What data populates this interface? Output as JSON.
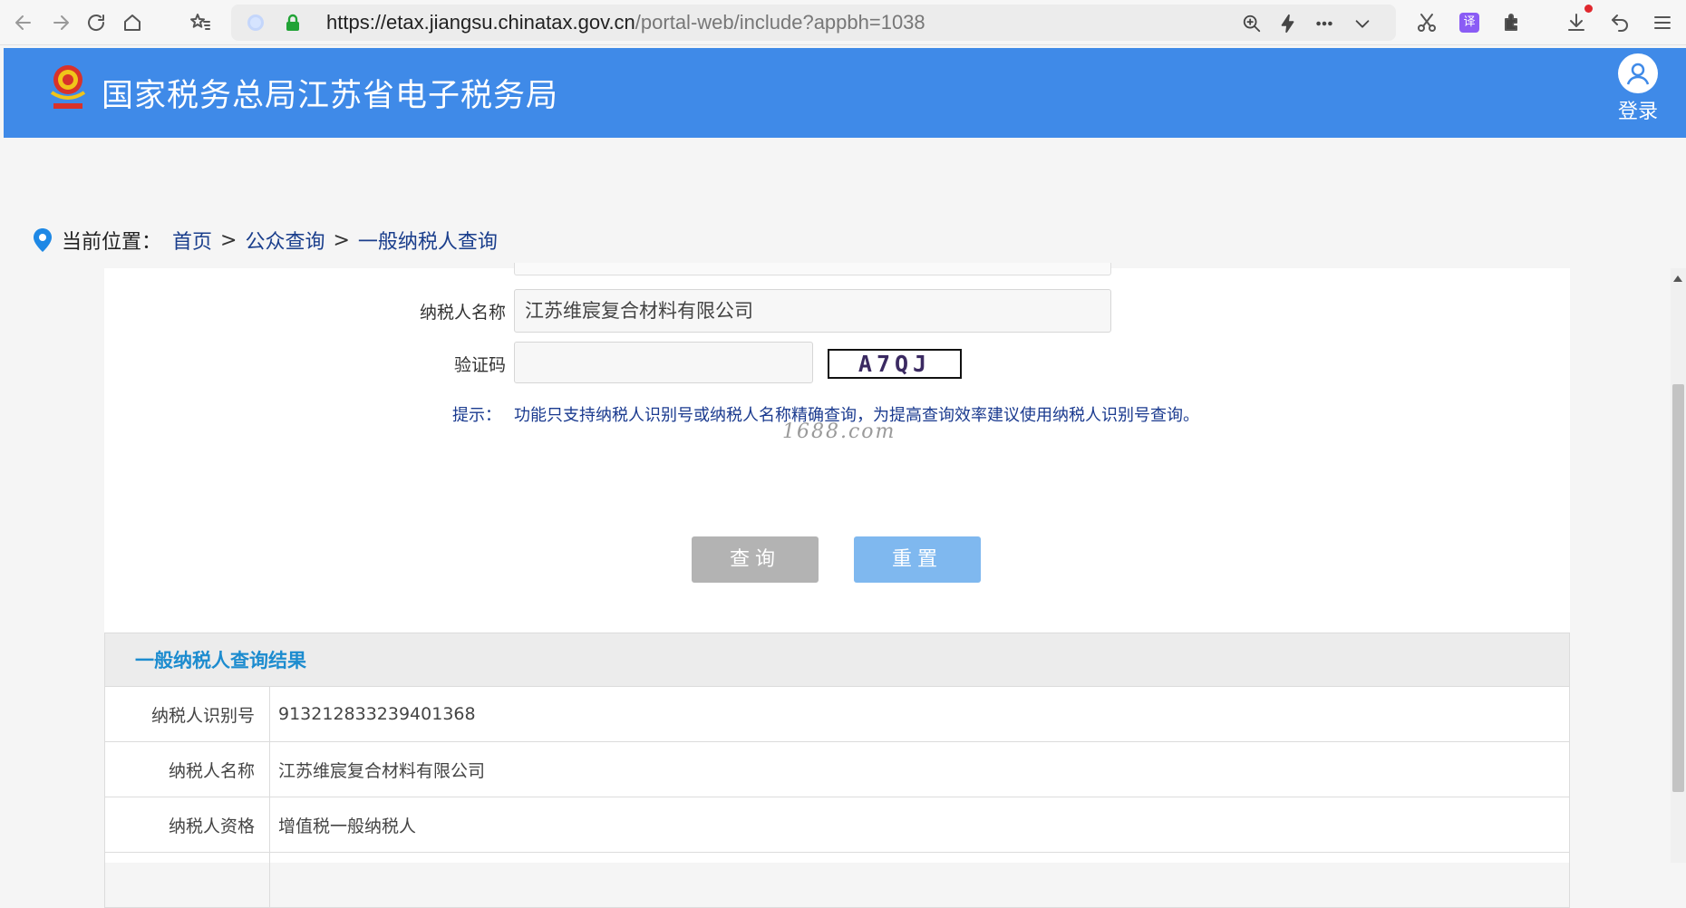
{
  "browser": {
    "url_host": "https://etax.jiangsu.chinatax.gov.cn",
    "url_path": "/portal-web/include?appbh=1038",
    "translate_label": "译"
  },
  "header": {
    "site_title": "国家税务总局江苏省电子税务局",
    "login_label": "登录",
    "brand_color": "#3f8ae8"
  },
  "breadcrumb": {
    "prefix": "当前位置：",
    "home": "首页",
    "sep": ">",
    "public_query": "公众查询",
    "current": "一般纳税人查询"
  },
  "form": {
    "taxpayer_name_label": "纳税人名称",
    "taxpayer_name_value": "江苏维宸复合材料有限公司",
    "captcha_label": "验证码",
    "captcha_value": "",
    "captcha_image_text": "A7QJ",
    "hint_label": "提示：",
    "hint_text": "功能只支持纳税人识别号或纳税人名称精确查询，为提高查询效率建议使用纳税人识别号查询。",
    "watermark": "1688.com",
    "query_button": "查询",
    "reset_button": "重置"
  },
  "result": {
    "title": "一般纳税人查询结果",
    "rows": [
      {
        "key": "纳税人识别号",
        "value": "913212833239401368"
      },
      {
        "key": "纳税人名称",
        "value": "江苏维宸复合材料有限公司"
      },
      {
        "key": "纳税人资格",
        "value": "增值税一般纳税人"
      },
      {
        "key": "",
        "value": ""
      }
    ]
  }
}
